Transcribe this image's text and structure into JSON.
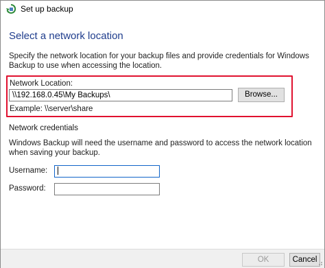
{
  "window": {
    "title": "Set up backup",
    "icon": "backup-icon"
  },
  "page": {
    "heading": "Select a network location",
    "description": "Specify the network location for your backup files and provide credentials for Windows Backup to use when accessing the location."
  },
  "network": {
    "label": "Network Location:",
    "value": "\\\\192.168.0.45\\My Backups\\",
    "browse_label": "Browse...",
    "example": "Example: \\\\server\\share"
  },
  "credentials": {
    "section_label": "Network credentials",
    "description": "Windows Backup will need the username and password to access the network location when saving your backup.",
    "username_label": "Username:",
    "username_value": "",
    "password_label": "Password:",
    "password_value": ""
  },
  "footer": {
    "ok_label": "OK",
    "cancel_label": "Cancel"
  },
  "colors": {
    "highlight": "#e0102e",
    "heading": "#1e3c8c",
    "focus": "#0f63c8"
  }
}
